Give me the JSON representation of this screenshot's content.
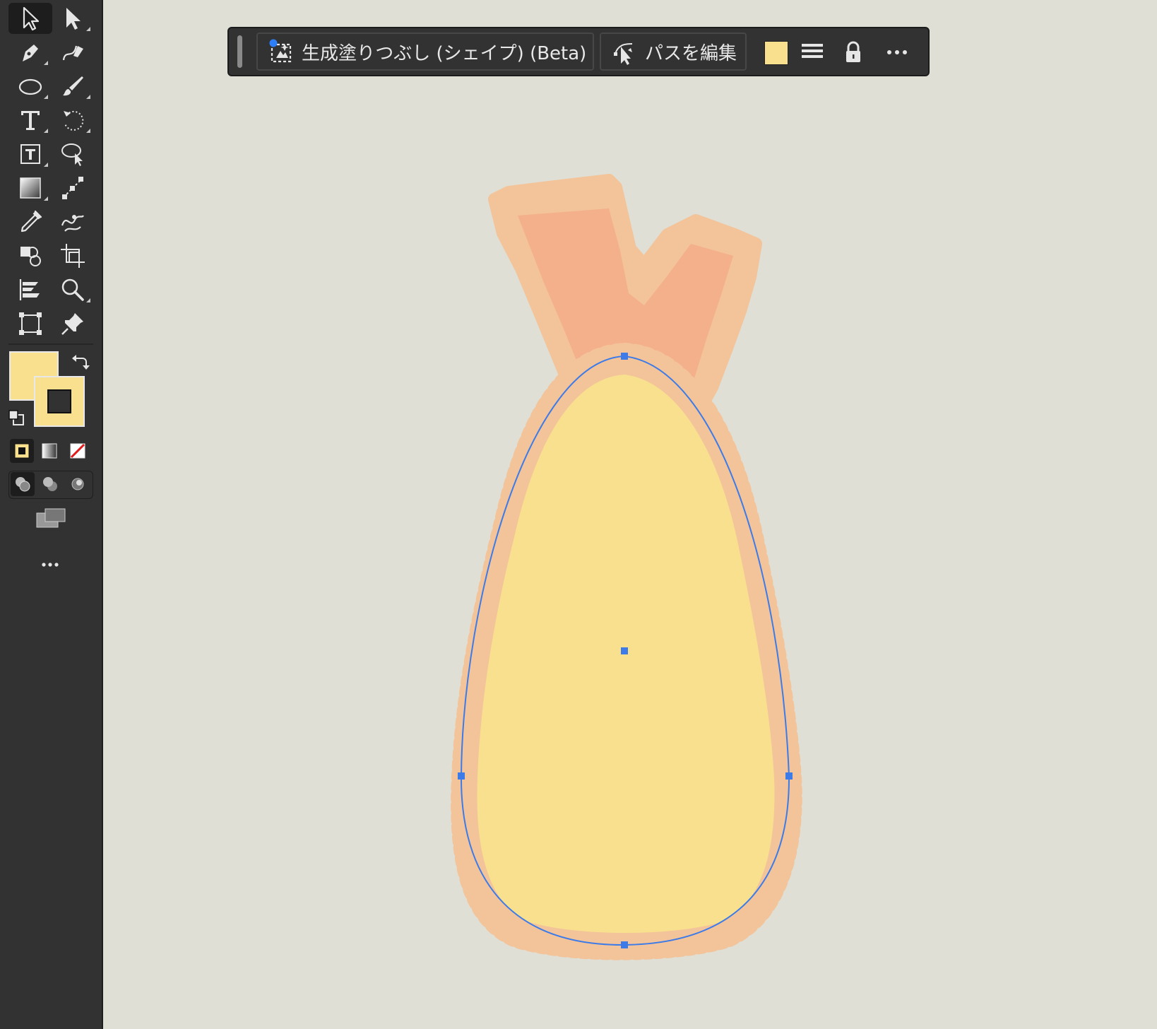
{
  "app": "Adobe Illustrator",
  "colors": {
    "fill": "#f8e08f",
    "shrimp_tail": "#f3b08b",
    "batter_outline": "#f3c399",
    "selection": "#3d7be8",
    "canvas": "#dfdfd5",
    "panel": "#323232"
  },
  "toolbox": {
    "tools": [
      {
        "icon": "selection-tool-icon",
        "active": true
      },
      {
        "icon": "direct-selection-tool-icon"
      },
      {
        "icon": "pen-tool-icon"
      },
      {
        "icon": "curvature-tool-icon"
      },
      {
        "icon": "ellipse-tool-icon"
      },
      {
        "icon": "paintbrush-tool-icon"
      },
      {
        "icon": "type-tool-icon"
      },
      {
        "icon": "rotate-tool-icon"
      },
      {
        "icon": "area-type-tool-icon"
      },
      {
        "icon": "lasso-tool-icon"
      },
      {
        "icon": "gradient-tool-icon"
      },
      {
        "icon": "blend-tool-icon"
      },
      {
        "icon": "eyedropper-tool-icon"
      },
      {
        "icon": "puppet-warp-tool-icon"
      },
      {
        "icon": "shape-builder-tool-icon"
      },
      {
        "icon": "artboard-tool-icon"
      },
      {
        "icon": "chart-tool-icon"
      },
      {
        "icon": "zoom-tool-icon"
      },
      {
        "icon": "free-transform-tool-icon"
      },
      {
        "icon": "pin-tool-icon"
      }
    ],
    "fill_color": "#f8e08f",
    "stroke_color": "#f8e08f"
  },
  "taskbar": {
    "generative_fill_label": "生成塗りつぶし (シェイプ) (Beta)",
    "edit_path_label": "パスを編集",
    "fill_swatch_color": "#f8e08f"
  }
}
